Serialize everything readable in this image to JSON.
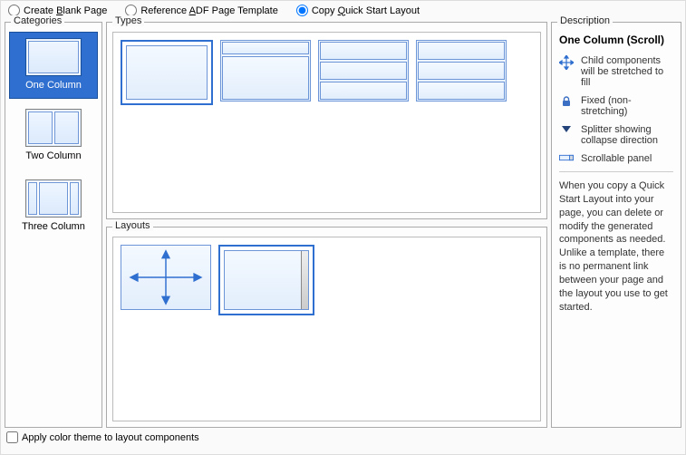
{
  "radios": {
    "create_blank": "Create Blank Page",
    "reference_adf": "Reference ADF Page Template",
    "copy_quick": "Copy Quick Start Layout",
    "selected": "copy_quick"
  },
  "panels": {
    "categories": "Categories",
    "types": "Types",
    "layouts": "Layouts",
    "description": "Description"
  },
  "categories": {
    "items": [
      {
        "label": "One Column"
      },
      {
        "label": "Two Column"
      },
      {
        "label": "Three Column"
      }
    ],
    "selected": 0
  },
  "description": {
    "title": "One Column (Scroll)",
    "legend": [
      {
        "icon": "stretch",
        "text": "Child components will be stretched to fill"
      },
      {
        "icon": "lock",
        "text": "Fixed (non-stretching)"
      },
      {
        "icon": "splitter",
        "text": "Splitter showing collapse direction"
      },
      {
        "icon": "scroll",
        "text": "Scrollable panel"
      }
    ],
    "body": "When you copy a Quick Start Layout into your page, you can delete or modify the generated components as needed. Unlike a template, there is no permanent link between your page and the layout you use to get started."
  },
  "footer": {
    "apply_theme": "Apply color theme to layout components"
  }
}
